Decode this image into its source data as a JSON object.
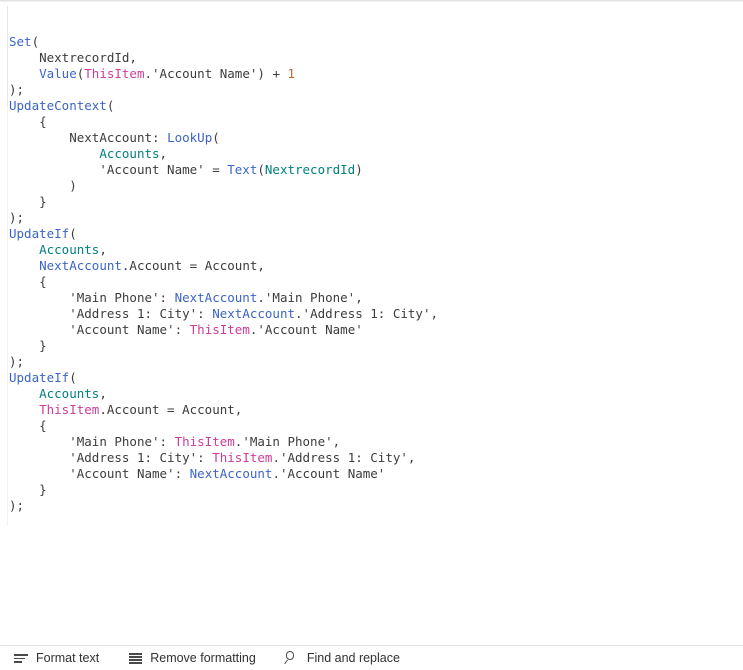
{
  "editor": {
    "language": "Power Fx",
    "font_size_px": 12.5,
    "colors": {
      "function": "#3c64c8",
      "this_item": "#cc3d99",
      "datasource": "#00807d",
      "variable": "#3c64c8",
      "number": "#c6692e",
      "plain": "#3c3c3c",
      "background": "#ffffff",
      "border": "#e4e4e4"
    },
    "lines": [
      {
        "indent": 0,
        "tokens": [
          {
            "t": "Set",
            "c": "fn"
          },
          {
            "t": "(",
            "c": "punct"
          }
        ]
      },
      {
        "indent": 1,
        "tokens": [
          {
            "t": "NextrecordId,",
            "c": "plain"
          }
        ]
      },
      {
        "indent": 1,
        "tokens": [
          {
            "t": "Value",
            "c": "fn"
          },
          {
            "t": "(",
            "c": "punct"
          },
          {
            "t": "ThisItem",
            "c": "self"
          },
          {
            "t": ".'Account Name'",
            "c": "plain"
          },
          {
            "t": ")",
            "c": "punct"
          },
          {
            "t": " + ",
            "c": "op"
          },
          {
            "t": "1",
            "c": "num"
          }
        ]
      },
      {
        "indent": 0,
        "tokens": [
          {
            "t": ");",
            "c": "punct"
          }
        ]
      },
      {
        "indent": 0,
        "tokens": [
          {
            "t": "UpdateContext",
            "c": "fn"
          },
          {
            "t": "(",
            "c": "punct"
          }
        ]
      },
      {
        "indent": 1,
        "tokens": [
          {
            "t": "{",
            "c": "punct"
          }
        ]
      },
      {
        "indent": 2,
        "tokens": [
          {
            "t": "NextAccount: ",
            "c": "plain"
          },
          {
            "t": "LookUp",
            "c": "fn"
          },
          {
            "t": "(",
            "c": "punct"
          }
        ]
      },
      {
        "indent": 3,
        "tokens": [
          {
            "t": "Accounts",
            "c": "ds"
          },
          {
            "t": ",",
            "c": "punct"
          }
        ]
      },
      {
        "indent": 3,
        "tokens": [
          {
            "t": "'Account Name' = ",
            "c": "plain"
          },
          {
            "t": "Text",
            "c": "fn"
          },
          {
            "t": "(",
            "c": "punct"
          },
          {
            "t": "NextrecordId",
            "c": "ds"
          },
          {
            "t": ")",
            "c": "punct"
          }
        ]
      },
      {
        "indent": 2,
        "tokens": [
          {
            "t": ")",
            "c": "punct"
          }
        ]
      },
      {
        "indent": 1,
        "tokens": [
          {
            "t": "}",
            "c": "punct"
          }
        ]
      },
      {
        "indent": 0,
        "tokens": [
          {
            "t": ");",
            "c": "punct"
          }
        ]
      },
      {
        "indent": 0,
        "tokens": [
          {
            "t": "UpdateIf",
            "c": "fn"
          },
          {
            "t": "(",
            "c": "punct"
          }
        ]
      },
      {
        "indent": 1,
        "tokens": [
          {
            "t": "Accounts",
            "c": "ds"
          },
          {
            "t": ",",
            "c": "punct"
          }
        ]
      },
      {
        "indent": 1,
        "tokens": [
          {
            "t": "NextAccount",
            "c": "var"
          },
          {
            "t": ".Account = Account,",
            "c": "plain"
          }
        ]
      },
      {
        "indent": 1,
        "tokens": [
          {
            "t": "{",
            "c": "punct"
          }
        ]
      },
      {
        "indent": 2,
        "tokens": [
          {
            "t": "'Main Phone': ",
            "c": "plain"
          },
          {
            "t": "NextAccount",
            "c": "var"
          },
          {
            "t": ".'Main Phone',",
            "c": "plain"
          }
        ]
      },
      {
        "indent": 2,
        "tokens": [
          {
            "t": "'Address 1: City': ",
            "c": "plain"
          },
          {
            "t": "NextAccount",
            "c": "var"
          },
          {
            "t": ".'Address 1: City',",
            "c": "plain"
          }
        ]
      },
      {
        "indent": 2,
        "tokens": [
          {
            "t": "'Account Name': ",
            "c": "plain"
          },
          {
            "t": "ThisItem",
            "c": "self"
          },
          {
            "t": ".'Account Name'",
            "c": "plain"
          }
        ]
      },
      {
        "indent": 1,
        "tokens": [
          {
            "t": "}",
            "c": "punct"
          }
        ]
      },
      {
        "indent": 0,
        "tokens": [
          {
            "t": ");",
            "c": "punct"
          }
        ]
      },
      {
        "indent": 0,
        "tokens": [
          {
            "t": "UpdateIf",
            "c": "fn"
          },
          {
            "t": "(",
            "c": "punct"
          }
        ]
      },
      {
        "indent": 1,
        "tokens": [
          {
            "t": "Accounts",
            "c": "ds"
          },
          {
            "t": ",",
            "c": "punct"
          }
        ]
      },
      {
        "indent": 1,
        "tokens": [
          {
            "t": "ThisItem",
            "c": "self"
          },
          {
            "t": ".Account = Account,",
            "c": "plain"
          }
        ]
      },
      {
        "indent": 1,
        "tokens": [
          {
            "t": "{",
            "c": "punct"
          }
        ]
      },
      {
        "indent": 2,
        "tokens": [
          {
            "t": "'Main Phone': ",
            "c": "plain"
          },
          {
            "t": "ThisItem",
            "c": "self"
          },
          {
            "t": ".'Main Phone',",
            "c": "plain"
          }
        ]
      },
      {
        "indent": 2,
        "tokens": [
          {
            "t": "'Address 1: City': ",
            "c": "plain"
          },
          {
            "t": "ThisItem",
            "c": "self"
          },
          {
            "t": ".'Address 1: City',",
            "c": "plain"
          }
        ]
      },
      {
        "indent": 2,
        "tokens": [
          {
            "t": "'Account Name': ",
            "c": "plain"
          },
          {
            "t": "NextAccount",
            "c": "var"
          },
          {
            "t": ".'Account Name'",
            "c": "plain"
          }
        ]
      },
      {
        "indent": 1,
        "tokens": [
          {
            "t": "}",
            "c": "punct"
          }
        ]
      },
      {
        "indent": 0,
        "tokens": [
          {
            "t": ");",
            "c": "punct"
          }
        ]
      }
    ],
    "plain_text": "Set(\n    NextrecordId,\n    Value(ThisItem.'Account Name') + 1\n);\nUpdateContext(\n    {\n        NextAccount: LookUp(\n            Accounts,\n            'Account Name' = Text(NextrecordId)\n        )\n    }\n);\nUpdateIf(\n    Accounts,\n    NextAccount.Account = Account,\n    {\n        'Main Phone': NextAccount.'Main Phone',\n        'Address 1: City': NextAccount.'Address 1: City',\n        'Account Name': ThisItem.'Account Name'\n    }\n);\nUpdateIf(\n    Accounts,\n    ThisItem.Account = Account,\n    {\n        'Main Phone': ThisItem.'Main Phone',\n        'Address 1: City': ThisItem.'Address 1: City',\n        'Account Name': NextAccount.'Account Name'\n    }\n);"
  },
  "toolbar": {
    "format_text_label": "Format text",
    "remove_formatting_label": "Remove formatting",
    "find_replace_label": "Find and replace",
    "icons": {
      "format_text": "format-text-icon",
      "remove_formatting": "remove-formatting-icon",
      "find_replace": "search-icon"
    }
  }
}
